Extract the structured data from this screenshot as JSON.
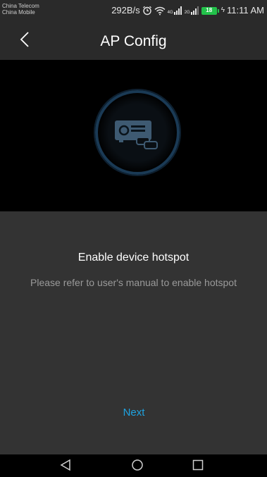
{
  "status_bar": {
    "carrier_1": "China Telecom",
    "carrier_2": "China Mobile",
    "net_speed": "292B/s",
    "signal_1_label": "4G",
    "signal_2_label": "2G",
    "battery_level": "18",
    "time": "11:11 AM",
    "icons": [
      "alarm-icon",
      "wifi-icon",
      "signal-icon",
      "signal-icon",
      "battery-icon",
      "charging-icon"
    ]
  },
  "header": {
    "title": "AP Config",
    "back_icon": "chevron-left-icon"
  },
  "hero": {
    "icon": "device-hotspot-icon"
  },
  "content": {
    "heading": "Enable device hotspot",
    "description": "Please refer to user's manual to enable hotspot",
    "next_label": "Next"
  },
  "nav_bar": {
    "icons": [
      "back-triangle-icon",
      "home-circle-icon",
      "recents-square-icon"
    ]
  },
  "colors": {
    "accent": "#1fa3e0",
    "bar_bg": "#2a2a2a",
    "content_bg": "#333333",
    "hero_bg": "#000000",
    "battery": "#22c24a"
  }
}
